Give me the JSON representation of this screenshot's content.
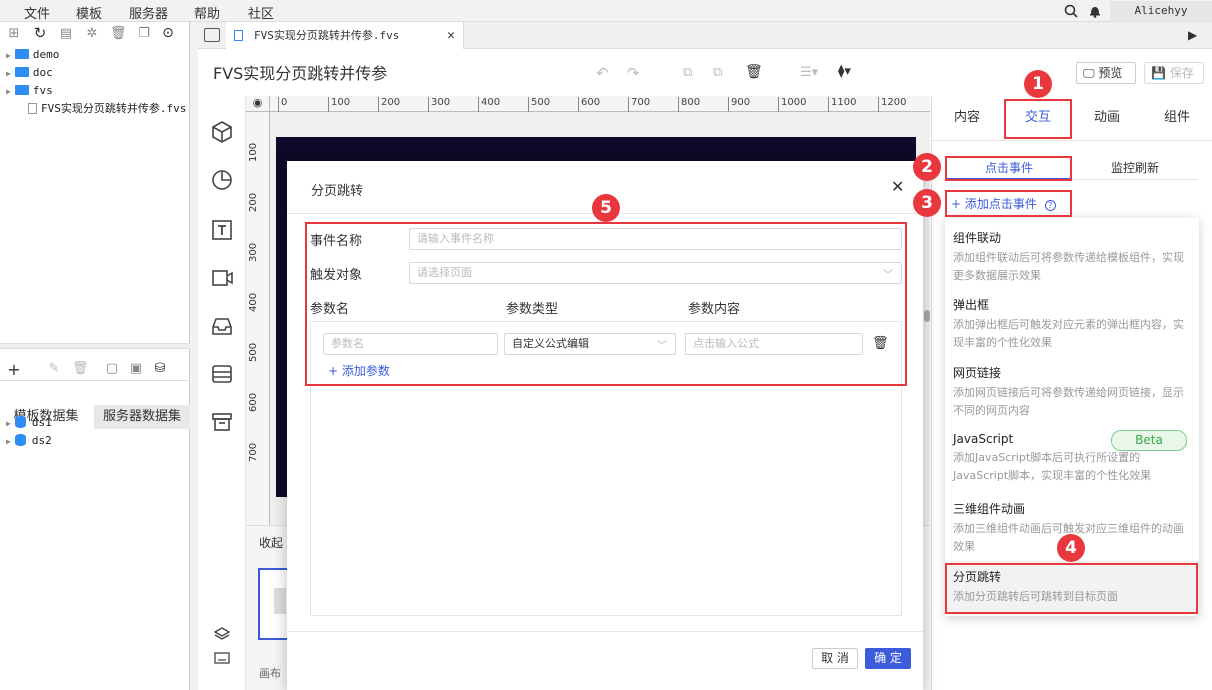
{
  "menubar": {
    "items": [
      "文件",
      "模板",
      "服务器",
      "帮助",
      "社区"
    ],
    "user": "Alicehyy"
  },
  "tree": {
    "items": [
      "demo",
      "doc",
      "fvs",
      "FVS实现分页跳转并传参.fvs"
    ]
  },
  "datasets": {
    "tabs": [
      "模板数据集",
      "服务器数据集"
    ],
    "items": [
      "ds1",
      "ds2"
    ]
  },
  "tab": {
    "file": "FVS实现分页跳转并传参.fvs"
  },
  "header": {
    "title": "FVS实现分页跳转并传参",
    "preview": "预览",
    "save": "保存"
  },
  "ruler": {
    "top": [
      "0",
      "100",
      "200",
      "300",
      "400",
      "500",
      "600",
      "700",
      "800",
      "900",
      "1000",
      "1100",
      "1200"
    ],
    "left": [
      "100",
      "200",
      "300",
      "400",
      "500",
      "600",
      "700"
    ]
  },
  "canvas": {
    "collapse": "收起",
    "canvas_label": "画布"
  },
  "rightpanel": {
    "tabs": [
      "内容",
      "交互",
      "动画",
      "组件"
    ],
    "subtabs": [
      "点击事件",
      "监控刷新"
    ],
    "add_event": "+ 添加点击事件"
  },
  "events": [
    {
      "title": "组件联动",
      "desc": "添加组件联动后可将参数传递给模板组件，实现更多数据展示效果"
    },
    {
      "title": "弹出框",
      "desc": "添加弹出框后可触发对应元素的弹出框内容，实现丰富的个性化效果"
    },
    {
      "title": "网页链接",
      "desc": "添加网页链接后可将参数传递给网页链接，显示不同的网页内容"
    },
    {
      "title": "JavaScript",
      "desc": "添加JavaScript脚本后可执行所设置的JavaScript脚本，实现丰富的个性化效果",
      "badge": "Beta"
    },
    {
      "title": "三维组件动画",
      "desc": "添加三维组件动画后可触发对应三维组件的动画效果"
    },
    {
      "title": "分页跳转",
      "desc": "添加分页跳转后可跳转到目标页面"
    }
  ],
  "modal": {
    "title": "分页跳转",
    "event_name_label": "事件名称",
    "event_name_placeholder": "请输入事件名称",
    "target_label": "触发对象",
    "target_placeholder": "请选择页面",
    "col_param_name": "参数名",
    "col_param_type": "参数类型",
    "col_param_content": "参数内容",
    "param_name_placeholder": "参数名",
    "param_type_value": "自定义公式编辑",
    "param_content_placeholder": "点击输入公式",
    "add_param": "+ 添加参数",
    "cancel": "取 消",
    "ok": "确 定"
  },
  "badges": [
    "1",
    "2",
    "3",
    "4",
    "5"
  ],
  "colors": {
    "accent": "#3b5bdb",
    "annotation": "#e8383d",
    "canvas": "#0c0a28"
  }
}
